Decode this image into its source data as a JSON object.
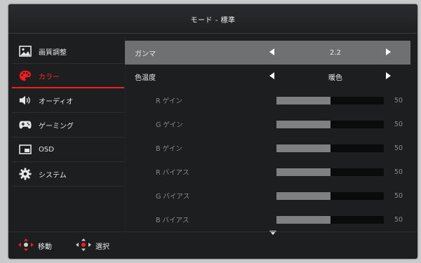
{
  "title": "モード - 標準",
  "sidebar": {
    "items": [
      {
        "label": "画質調整",
        "icon": "image-icon"
      },
      {
        "label": "カラー",
        "icon": "palette-icon",
        "active": true
      },
      {
        "label": "オーディオ",
        "icon": "speaker-icon"
      },
      {
        "label": "ゲーミング",
        "icon": "gamepad-icon"
      },
      {
        "label": "OSD",
        "icon": "osd-icon"
      },
      {
        "label": "システム",
        "icon": "gear-icon"
      }
    ]
  },
  "main": {
    "gamma": {
      "label": "ガンマ",
      "value": "2.2"
    },
    "color_temp": {
      "label": "色温度",
      "value": "暖色"
    },
    "sliders": [
      {
        "label": "R ゲイン",
        "value": "50",
        "level": 0.5
      },
      {
        "label": "G ゲイン",
        "value": "50",
        "level": 0.5
      },
      {
        "label": "B ゲイン",
        "value": "50",
        "level": 0.5
      },
      {
        "label": "R バイアス",
        "value": "50",
        "level": 0.5
      },
      {
        "label": "G バイアス",
        "value": "50",
        "level": 0.5
      },
      {
        "label": "B バイアス",
        "value": "50",
        "level": 0.5
      }
    ]
  },
  "footer": {
    "move_label": "移動",
    "select_label": "選択"
  },
  "colors": {
    "accent": "#ff1a1a",
    "panel": "#1d1e20",
    "highlight": "#6e7072"
  }
}
